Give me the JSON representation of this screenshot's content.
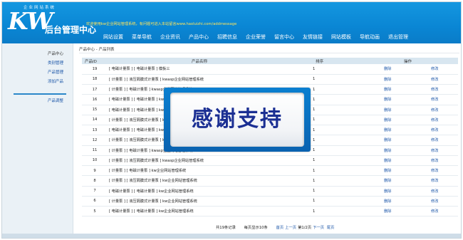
{
  "header": {
    "logo": "KW",
    "logo_small": "企业网站系统",
    "logo_cn": "后台管理中心",
    "welcome": "欢迎使用kw企业网站管理系统，有问题可进入本站留言www.haoluizhi.com/addmessage",
    "nav": [
      "网站设置",
      "菜单导航",
      "企业资讯",
      "产品中心",
      "招聘信息",
      "企业荣誉",
      "留言中心",
      "友情链接",
      "网站模板",
      "导航动画",
      "退出管理"
    ]
  },
  "sidebar": {
    "title": "产品中心",
    "links": [
      "类别管理",
      "产品管理",
      "添加产品"
    ],
    "bottom_link": "产品调整"
  },
  "breadcrumb": "产品中心 - 产品列表",
  "table": {
    "headers": [
      "产品ID",
      "产品名称",
      "排序",
      "操作"
    ],
    "rows": [
      {
        "id": "19",
        "name": "[ 电磁计量泵 ] [ 电磁计量泵 ]      模板三",
        "sort": "1",
        "del": "删除",
        "edit": "修改"
      },
      {
        "id": "18",
        "name": "[ 计量泵 ] [ 液压隔膜式计量泵 ]      kwasp企业网站管理系统",
        "sort": "1",
        "del": "删除",
        "edit": "修改"
      },
      {
        "id": "17",
        "name": "[ 计量泵 ] [ 电磁计量泵 ]      kwasp企业网站管理系统",
        "sort": "1",
        "del": "删除",
        "edit": "修改"
      },
      {
        "id": "16",
        "name": "[ 电磁计量泵 ] [ 电磁计量泵 ]      kwasp企业网站管理系统",
        "sort": "1",
        "del": "删除",
        "edit": "修改"
      },
      {
        "id": "15",
        "name": "[ 电磁计量泵 ] [ 电磁计量泵 ]      kwasp企业网站管理系统",
        "sort": "1",
        "del": "删除",
        "edit": "修改"
      },
      {
        "id": "14",
        "name": "[ 计量泵 ] [ 液压隔膜式计量泵 ]      kwasp企业网站管理系统",
        "sort": "1",
        "del": "删除",
        "edit": "修改"
      },
      {
        "id": "13",
        "name": "[ 电磁计量泵 ] [ 电磁计量泵 ]      kwasp企业网站管理系统",
        "sort": "1",
        "del": "删除",
        "edit": "修改"
      },
      {
        "id": "12",
        "name": "[ 计量泵 ] [ 液压隔膜式计量泵 ]      kwasp企业网站管理系统",
        "sort": "1",
        "del": "删除",
        "edit": "修改"
      },
      {
        "id": "11",
        "name": "[ 计量泵 ] [ 电磁计量泵 ]      kwasp企业网站管理系统",
        "sort": "1",
        "del": "删除",
        "edit": "修改"
      },
      {
        "id": "10",
        "name": "[ 计量泵 ] [ 液压隔膜式计量泵 ]      kwasp企业网站管理系统",
        "sort": "1",
        "del": "删除",
        "edit": "修改"
      },
      {
        "id": "9",
        "name": "[ 计量泵 ] [ 电磁计量泵 ]      kw企业网站管理系统",
        "sort": "1",
        "del": "删除",
        "edit": "修改"
      },
      {
        "id": "8",
        "name": "[ 计量泵 ] [ 液压隔膜式计量泵 ]      kw企业网站管理系统",
        "sort": "1",
        "del": "删除",
        "edit": "修改"
      },
      {
        "id": "7",
        "name": "[ 电磁计量泵 ] [ 电磁计量泵 ]      kw企业网站管理系统",
        "sort": "1",
        "del": "删除",
        "edit": "修改"
      },
      {
        "id": "6",
        "name": "[ 计量泵 ] [ 液压隔膜式计量泵 ]      kw企业网站管理系统",
        "sort": "1",
        "del": "删除",
        "edit": "修改"
      },
      {
        "id": "5",
        "name": "[ 电磁计量泵 ] [ 电磁计量泵 ]      kw企业网站管理系统",
        "sort": "1",
        "del": "删除",
        "edit": "修改"
      }
    ]
  },
  "pager": {
    "total": "共19条记录",
    "per_page": "每页显示10条",
    "links": [
      "首页",
      "上一页",
      "第1/2页",
      "下一页",
      "尾页"
    ]
  },
  "overlay_text": "感谢支持",
  "colors": {
    "header_bg": "#0a86d4",
    "nav_text": "#ffffff",
    "welcome_text": "#ffe35a",
    "link": "#1a55a8",
    "overlay_text": "#1b2f93"
  }
}
